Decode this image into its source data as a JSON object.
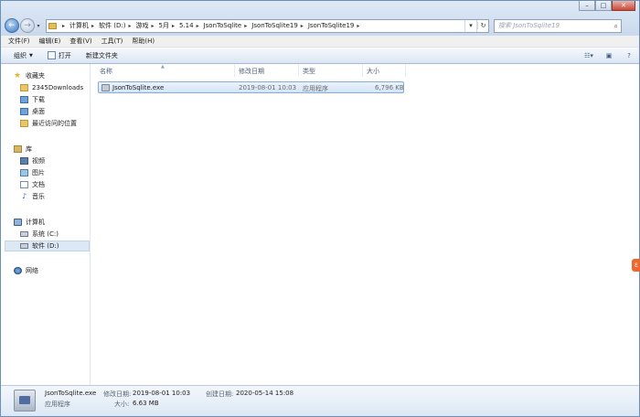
{
  "window": {
    "ghost_titles": [
      "",
      "",
      "",
      ""
    ]
  },
  "nav": {
    "back_icon": "back-arrow-icon",
    "forward_icon": "forward-arrow-icon"
  },
  "address": {
    "crumbs": [
      "计算机",
      "软件 (D:)",
      "游戏",
      "5月",
      "5.14",
      "JsonToSqlite",
      "JsonToSqlite19",
      "JsonToSqlite19"
    ]
  },
  "search": {
    "placeholder": "搜索 JsonToSqlite19"
  },
  "menu": [
    "文件(F)",
    "编辑(E)",
    "查看(V)",
    "工具(T)",
    "帮助(H)"
  ],
  "toolbar": {
    "organize": "组织",
    "open": "打开",
    "new_folder": "新建文件夹"
  },
  "sidebar": {
    "favorites_header": "收藏夹",
    "favorites": [
      "2345Downloads",
      "下载",
      "桌面",
      "最近访问的位置"
    ],
    "libraries_header": "库",
    "libraries": [
      "视频",
      "图片",
      "文档",
      "音乐"
    ],
    "computer_header": "计算机",
    "drives": [
      "系统 (C:)",
      "软件 (D:)"
    ],
    "network_header": "网络"
  },
  "columns": {
    "name": "名称",
    "modified": "修改日期",
    "type": "类型",
    "size": "大小"
  },
  "files": [
    {
      "name": "JsonToSqlite.exe",
      "modified": "2019-08-01 10:03",
      "type": "应用程序",
      "size": "6,796 KB"
    }
  ],
  "details": {
    "filename": "JsonToSqlite.exe",
    "type": "应用程序",
    "modified_label": "修改日期:",
    "modified_value": "2019-08-01 10:03",
    "size_label": "大小:",
    "size_value": "6.63 MB",
    "created_label": "创建日期:",
    "created_value": "2020-05-14 15:08"
  },
  "colors": {
    "accent": "#3b78c0",
    "selection": "#d4e5f8",
    "toolbar": "#dbe6f3"
  }
}
